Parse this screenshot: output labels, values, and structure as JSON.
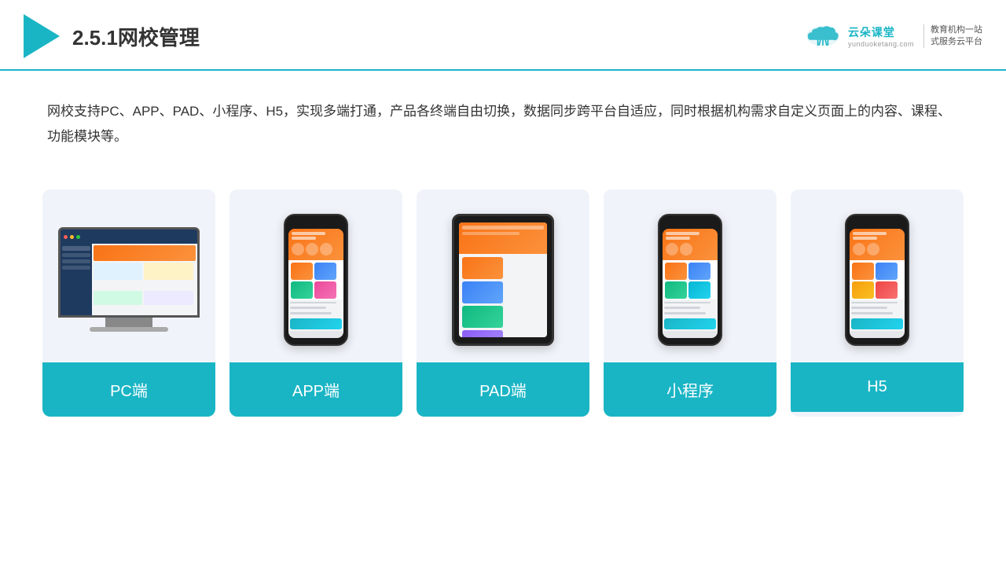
{
  "header": {
    "title": "2.5.1网校管理",
    "brand_name": "云朵课堂",
    "brand_domain": "yunduoketang.com",
    "brand_slogan_line1": "教育机构一站",
    "brand_slogan_line2": "式服务云平台"
  },
  "description": {
    "text": "网校支持PC、APP、PAD、小程序、H5，实现多端打通，产品各终端自由切换，数据同步跨平台自适应，同时根据机构需求自定义页面上的内容、课程、功能模块等。"
  },
  "cards": [
    {
      "label": "PC端",
      "type": "pc"
    },
    {
      "label": "APP端",
      "type": "phone"
    },
    {
      "label": "PAD端",
      "type": "tablet"
    },
    {
      "label": "小程序",
      "type": "phone"
    },
    {
      "label": "H5",
      "type": "phone"
    }
  ]
}
